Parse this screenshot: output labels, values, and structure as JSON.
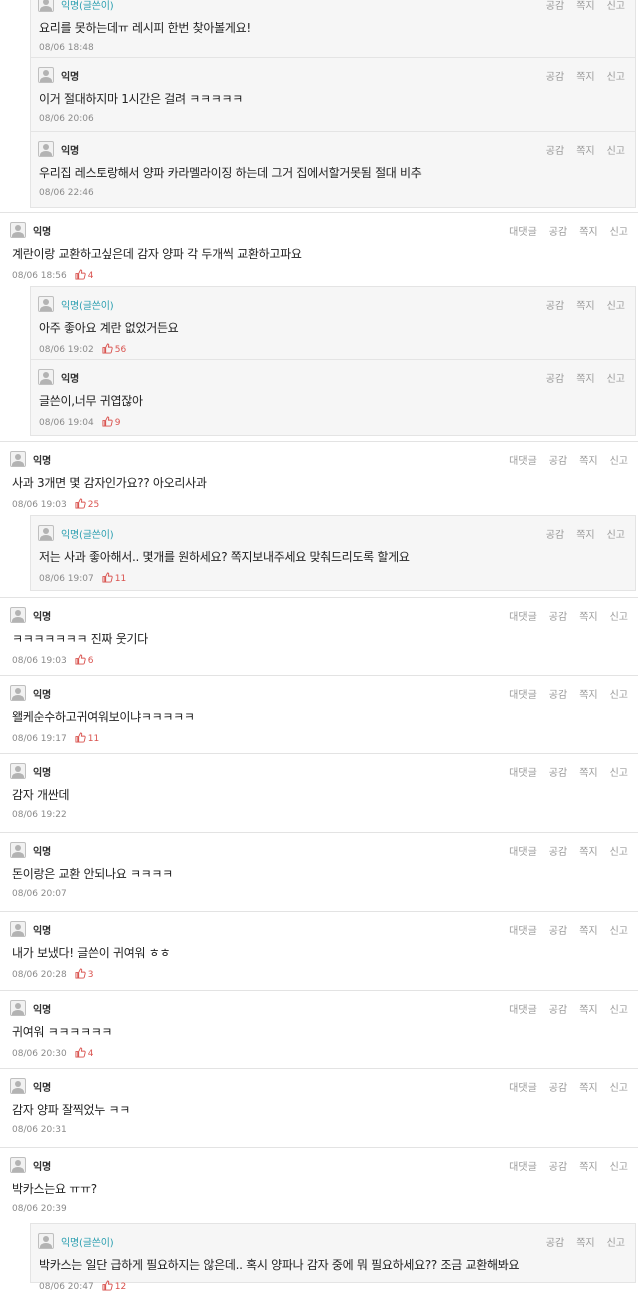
{
  "actions": {
    "reply": "대댓글",
    "like": "공감",
    "message": "쪽지",
    "report": "신고"
  },
  "colors": {
    "like_count": "#d9534f",
    "op_author": "#2b9fb0"
  },
  "comments": [
    {
      "kind": "reply",
      "author": "익명(글쓴이)",
      "op": true,
      "text": "요리를 못하는데ㅠ 레시피 한번 찾아볼게요!",
      "time": "08/06 18:48",
      "likes": null
    },
    {
      "kind": "reply",
      "author": "익명",
      "op": false,
      "text": "이거 절대하지마 1시간은 걸려 ㅋㅋㅋㅋㅋ",
      "time": "08/06 20:06",
      "likes": null
    },
    {
      "kind": "reply",
      "author": "익명",
      "op": false,
      "text": "우리집 레스토랑해서 양파 카라멜라이징 하는데 그거 집에서할거못됨 절대 비추",
      "time": "08/06 22:46",
      "likes": null
    },
    {
      "kind": "top",
      "author": "익명",
      "op": false,
      "text": "계란이랑 교환하고싶은데 감자 양파 각 두개씩 교환하고파요",
      "time": "08/06 18:56",
      "likes": "4"
    },
    {
      "kind": "reply",
      "author": "익명(글쓴이)",
      "op": true,
      "text": "아주 좋아요 계란 없었거든요",
      "time": "08/06 19:02",
      "likes": "56"
    },
    {
      "kind": "reply",
      "author": "익명",
      "op": false,
      "text": "글쓴이,너무 귀엽잖아",
      "time": "08/06 19:04",
      "likes": "9"
    },
    {
      "kind": "top",
      "author": "익명",
      "op": false,
      "text": "사과 3개면 몇 감자인가요?? 아오리사과",
      "time": "08/06 19:03",
      "likes": "25"
    },
    {
      "kind": "reply",
      "author": "익명(글쓴이)",
      "op": true,
      "text": "저는 사과 좋아해서.. 몇개를 원하세요? 쪽지보내주세요 맞춰드리도록 할게요",
      "time": "08/06 19:07",
      "likes": "11"
    },
    {
      "kind": "top",
      "author": "익명",
      "op": false,
      "text": "ㅋㅋㅋㅋㅋㅋㅋ 진짜 웃기다",
      "time": "08/06 19:03",
      "likes": "6"
    },
    {
      "kind": "top",
      "author": "익명",
      "op": false,
      "text": "왤케순수하고귀여워보이냐ㅋㅋㅋㅋㅋ",
      "time": "08/06 19:17",
      "likes": "11"
    },
    {
      "kind": "top",
      "author": "익명",
      "op": false,
      "text": "감자 개싼데",
      "time": "08/06 19:22",
      "likes": null
    },
    {
      "kind": "top",
      "author": "익명",
      "op": false,
      "text": "돈이랑은 교환 안되나요 ㅋㅋㅋㅋ",
      "time": "08/06 20:07",
      "likes": null
    },
    {
      "kind": "top",
      "author": "익명",
      "op": false,
      "text": "내가 보냈다! 글쓴이 귀여워 ㅎㅎ",
      "time": "08/06 20:28",
      "likes": "3"
    },
    {
      "kind": "top",
      "author": "익명",
      "op": false,
      "text": "귀여워 ㅋㅋㅋㅋㅋㅋ",
      "time": "08/06 20:30",
      "likes": "4"
    },
    {
      "kind": "top",
      "author": "익명",
      "op": false,
      "text": "감자 양파 잘찍었누 ㅋㅋ",
      "time": "08/06 20:31",
      "likes": null
    },
    {
      "kind": "top",
      "author": "익명",
      "op": false,
      "text": "박카스는요 ㅠㅠ?",
      "time": "08/06 20:39",
      "likes": null
    },
    {
      "kind": "reply",
      "author": "익명(글쓴이)",
      "op": true,
      "text": "박카스는 일단 급하게 필요하지는 않은데.. 혹시 양파나 감자 중에 뭐 필요하세요?? 조금 교환해봐요",
      "time": "08/06 20:47",
      "likes": "12"
    }
  ]
}
